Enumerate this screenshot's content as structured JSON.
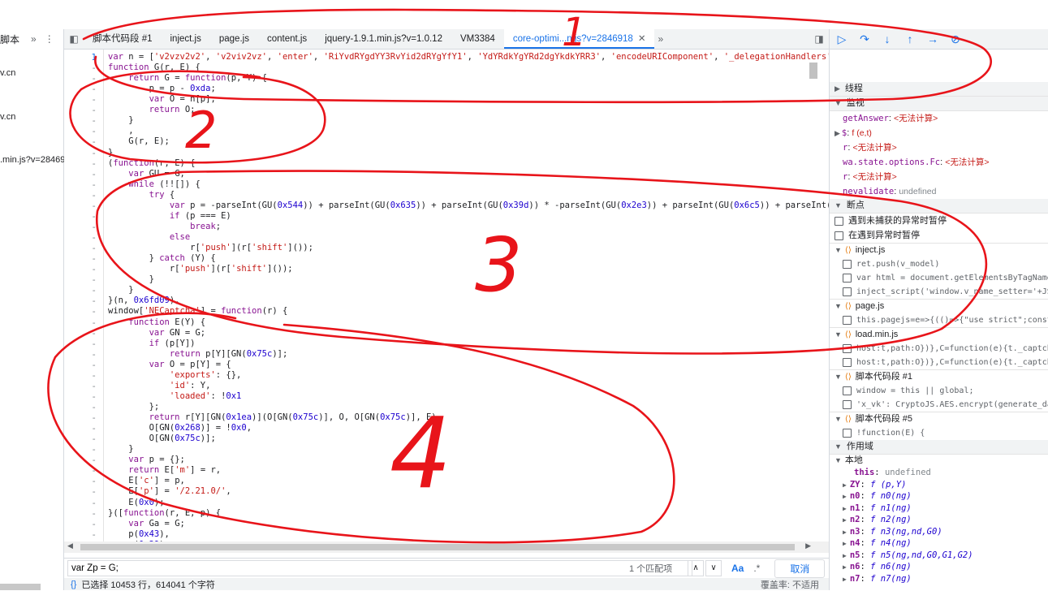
{
  "left_panel": {
    "header_label": "脚本",
    "items": [
      "v.cn",
      "v.cn",
      ".min.js?v=28469"
    ]
  },
  "tabs": [
    {
      "label": "脚本代码段 #1"
    },
    {
      "label": "inject.js"
    },
    {
      "label": "page.js"
    },
    {
      "label": "content.js"
    },
    {
      "label": "jquery-1.9.1.min.js?v=1.0.12"
    },
    {
      "label": "VM3384"
    },
    {
      "label": "core-optimi...n.js?v=2846918",
      "active": true
    }
  ],
  "code": {
    "first_line_number": "1",
    "line_marker": "-",
    "lines": [
      "var n = ['v2vzv2v2', 'v2viv2vz', 'enter', 'RiYvdRYgdYY3RvYid2dRYgYfY1', 'YdYRdkYgYRd2dgYkdkYRR3', 'encodeURIComponent', '_delegationHandlers', '536",
      "function G(r, E) {",
      "    return G = function(p, Y) {",
      "        p = p - 0xda;",
      "        var O = n[p];",
      "        return O;",
      "    }",
      "    ,",
      "    G(r, E);",
      "}",
      "(function(r, E) {",
      "    var GU = G;",
      "    while (!![]) {",
      "        try {",
      "            var p = -parseInt(GU(0x544)) + parseInt(GU(0x635)) + parseInt(GU(0x39d)) * -parseInt(GU(0x2e3)) + parseInt(GU(0x6c5)) + parseInt(GU(0x7",
      "            if (p === E)",
      "                break;",
      "            else",
      "                r['push'](r['shift']());",
      "        } catch (Y) {",
      "            r['push'](r['shift']());",
      "        }",
      "    }",
      "}(n, 0x6fd09),",
      "window['NECaptcha'] = function(r) {",
      "    function E(Y) {",
      "        var GN = G;",
      "        if (p[Y])",
      "            return p[Y][GN(0x75c)];",
      "        var O = p[Y] = {",
      "            'exports': {},",
      "            'id': Y,",
      "            'loaded': !0x1",
      "        };",
      "        return r[Y][GN(0x1ea)](O[GN(0x75c)], O, O[GN(0x75c)], E),",
      "        O[GN(0x268)] = !0x0,",
      "        O[GN(0x75c)];",
      "    }",
      "    var p = {};",
      "    return E['m'] = r,",
      "    E['c'] = p,",
      "    E['p'] = '/2.21.0/',",
      "    E(0x0);",
      "}([function(r, E, p) {",
      "    var Ga = G;",
      "    p(0x43),",
      "    p(0x39),"
    ]
  },
  "search": {
    "value": "var Zp = G;",
    "match_count": "1 个匹配项",
    "case_label": "Aa",
    "regex_label": ".*",
    "cancel_label": "取消"
  },
  "status": {
    "selection": "已选择 10453 行，614041 个字符",
    "coverage": "覆盖率: 不适用"
  },
  "debugger": {
    "threads_label": "线程",
    "watch_label": "监视",
    "watch": [
      {
        "key": "getAnswer",
        "value": "<无法计算>"
      },
      {
        "key": "$",
        "value": "f (e,t)",
        "expandable": true
      },
      {
        "key": "r",
        "value": "<无法计算>"
      },
      {
        "key": "wa.state.options.Fc",
        "value": "<无法计算>"
      },
      {
        "key": "r",
        "value": "<无法计算>"
      },
      {
        "key": "nevalidate",
        "value": "undefined"
      }
    ],
    "breakpoints_label": "断点",
    "pause_uncaught": "遇到未捕获的异常时暂停",
    "pause_caught": "在遇到异常时暂停",
    "bp_groups": [
      {
        "file": "inject.js",
        "lines": [
          "ret.push(v_model)",
          "var html = document.getElementsByTagName",
          "inject_script('window.v_name_setter='+JS"
        ]
      },
      {
        "file": "page.js",
        "lines": [
          "this.pagejs=e=>{(()=>{\"use strict\";const"
        ]
      },
      {
        "file": "load.min.js",
        "lines": [
          "host:t,path:O})},C=function(e){t._captch",
          "host:t,path:O})},C=function(e){t._captch"
        ]
      },
      {
        "file": "脚本代码段 #1",
        "lines": [
          "window = this || global;",
          "'x_vk': CryptoJS.AES.encrypt(generate_da"
        ]
      },
      {
        "file": "脚本代码段 #5",
        "lines": [
          "!function(E) {"
        ]
      }
    ],
    "scope_label": "作用域",
    "local_label": "本地",
    "scope_items": [
      {
        "name": "this",
        "value": "undefined",
        "plain": true
      },
      {
        "name": "ZY",
        "value": "f (p,Y)"
      },
      {
        "name": "n0",
        "value": "f n0(ng)"
      },
      {
        "name": "n1",
        "value": "f n1(ng)"
      },
      {
        "name": "n2",
        "value": "f n2(ng)"
      },
      {
        "name": "n3",
        "value": "f n3(ng,nd,G0)"
      },
      {
        "name": "n4",
        "value": "f n4(ng)"
      },
      {
        "name": "n5",
        "value": "f n5(ng,nd,G0,G1,G2)"
      },
      {
        "name": "n6",
        "value": "f n6(ng)"
      },
      {
        "name": "n7",
        "value": "f n7(ng)"
      }
    ]
  },
  "annotations": [
    "1",
    "2",
    "3",
    "4"
  ],
  "colors": {
    "annotation": "#e8141a",
    "accent": "#1a73e8"
  }
}
